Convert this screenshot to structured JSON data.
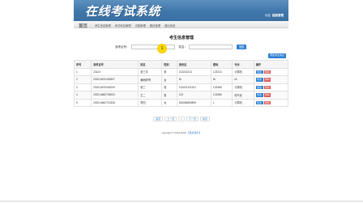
{
  "header": {
    "title": "在线考试系统",
    "user_prefix": "欢迎",
    "user_name": "超级管理"
  },
  "nav": {
    "home": "首页",
    "items": [
      "考生信息管理",
      "考试科目管理",
      "试卷管理",
      "题目管理",
      "退出系统"
    ]
  },
  "page_title": "考生信息管理",
  "search": {
    "label_id": "准考证号：",
    "value_id": "",
    "label_name": "姓名：",
    "value_name": "",
    "button": "搜索"
  },
  "cursor_label": "1",
  "add_button": "添加考生信息",
  "table": {
    "headers": [
      "序号",
      "准考证号",
      "姓名",
      "性别",
      "身份证",
      "密码",
      "专业",
      "操作"
    ],
    "rows": [
      [
        "1",
        "23123",
        "张三丰",
        "男",
        "213213213",
        "123213",
        "计算机"
      ],
      [
        "2",
        "202014670430507",
        "赖雨婷哥",
        "女",
        "Ni",
        "Ni",
        "Ni"
      ],
      [
        "3",
        "202014670004209",
        "张三",
        "男",
        "123213121321",
        "123456",
        "计算机"
      ],
      [
        "4",
        "202014662706003",
        "王二",
        "男",
        "123",
        "123456",
        "电气化"
      ],
      [
        "5",
        "202014662710308",
        "李四",
        "女",
        "526056859899",
        "1",
        "计算机"
      ]
    ],
    "edit_label": "修改",
    "delete_label": "删除"
  },
  "pager": [
    "首页",
    "上一页",
    "1",
    "下一页",
    "尾页"
  ],
  "footer": {
    "text": "copyright © 2013-2019 ",
    "link": "【联系我们】"
  },
  "colors": {
    "banner": "#3f77ab",
    "primary_button": "#2d7fd1",
    "danger_button": "#d9534f",
    "cursor_highlight": "#f6d200"
  }
}
